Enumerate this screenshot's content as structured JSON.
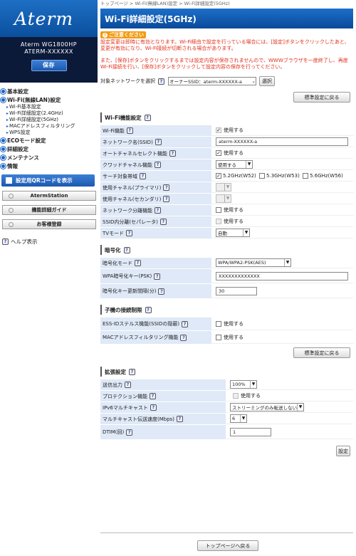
{
  "sidebar": {
    "logo": "Aterm",
    "model_line1": "Aterm WG1800HP",
    "model_line2": "ATERM-XXXXXX",
    "save_label": "保存",
    "nav": [
      {
        "label": "基本設定"
      },
      {
        "label": "Wi-Fi(無線LAN)設定",
        "children": [
          "Wi-Fi基本設定",
          "Wi-Fi詳細設定(2.4GHz)",
          "Wi-Fi詳細設定(5GHz)",
          "MACアドレスフィルタリング",
          "WPS設定"
        ]
      },
      {
        "label": "ECOモード設定"
      },
      {
        "label": "詳細設定"
      },
      {
        "label": "メンテナンス"
      },
      {
        "label": "情報"
      }
    ],
    "qr_label": "設定用QRコードを表示",
    "btn_atermstation": "AtermStation",
    "btn_guide": "機能詳細ガイド",
    "btn_register": "お客様登録",
    "help_label": "ヘルプ表示"
  },
  "breadcrumb": "トップページ > Wi-Fi(無線LAN)設定 > Wi-Fi詳細設定(5GHz)",
  "page_title": "Wi-Fi詳細設定(5GHz)",
  "notice": {
    "label": "ご注意ください",
    "p1": "設定変更は即時に有効となります。Wi-Fi経由で設定を行っている場合には、[設定]ボタンをクリックしたあと、変更が有効になり、Wi-Fi接続が切断される場合があります。",
    "p2": "また、[保存]ボタンをクリックするまでは設定内容が保存されませんので、WWWブラウザを一度終了し、再度Wi-Fi接続を行い、[保存]ボタンをクリックして設定内容の保存を行ってください。"
  },
  "network_select": {
    "label": "対象ネットワークを選択",
    "value": "オーナーSSID：aterm-XXXXXX-a",
    "button": "選択"
  },
  "default_btn": "標準設定に戻る",
  "wifi_func": {
    "heading": "Wi-Fi機能設定",
    "wifi_label": "Wi-Fi機能",
    "wifi_value": "使用する",
    "ssid_label": "ネットワーク名(SSID)",
    "ssid_value": "aterm-XXXXXX-a",
    "autoch_label": "オートチャネルセレクト機能",
    "autoch_value": "使用する",
    "quad_label": "クワッドチャネル機能",
    "quad_value": "使用する",
    "band_label": "サーチ対象帯域",
    "band_w52": "5.2GHz(W52)",
    "band_w53": "5.3GHz(W53)",
    "band_w56": "5.6GHz(W56)",
    "ch_primary_label": "使用チャネル(プライマリ)",
    "ch_secondary_label": "使用チャネル(セカンダリ)",
    "netsep_label": "ネットワーク分離機能",
    "netsep_value": "使用する",
    "ssidsep_label": "SSID内分離(セパレータ)",
    "ssidsep_value": "使用する",
    "tv_label": "TVモード",
    "tv_value": "自動"
  },
  "encryption": {
    "heading": "暗号化",
    "mode_label": "暗号化モード",
    "mode_value": "WPA/WPA2-PSK(AES)",
    "psk_label": "WPA暗号化キー(PSK)",
    "psk_value": "XXXXXXXXXXXXX",
    "interval_label": "暗号化キー更新間隔(分)",
    "interval_value": "30"
  },
  "client_limit": {
    "heading": "子機の接続制限",
    "stealth_label": "ESS-IDステルス機能(SSIDの隠蔽)",
    "stealth_value": "使用する",
    "mac_label": "MACアドレスフィルタリング機能",
    "mac_value": "使用する"
  },
  "extended": {
    "heading": "拡張設定",
    "power_label": "送信出力",
    "power_value": "100%",
    "protect_label": "プロテクション機能",
    "protect_value": "使用する",
    "ipv6_label": "IPv6マルチキャスト",
    "ipv6_value": "ストリーミングのみ転送しない",
    "mcast_label": "マルチキャスト伝送速度(Mbps)",
    "mcast_value": "6",
    "dtim_label": "DTIM(回)",
    "dtim_value": "1"
  },
  "set_btn": "設定",
  "top_btn": "トップページへ戻る"
}
